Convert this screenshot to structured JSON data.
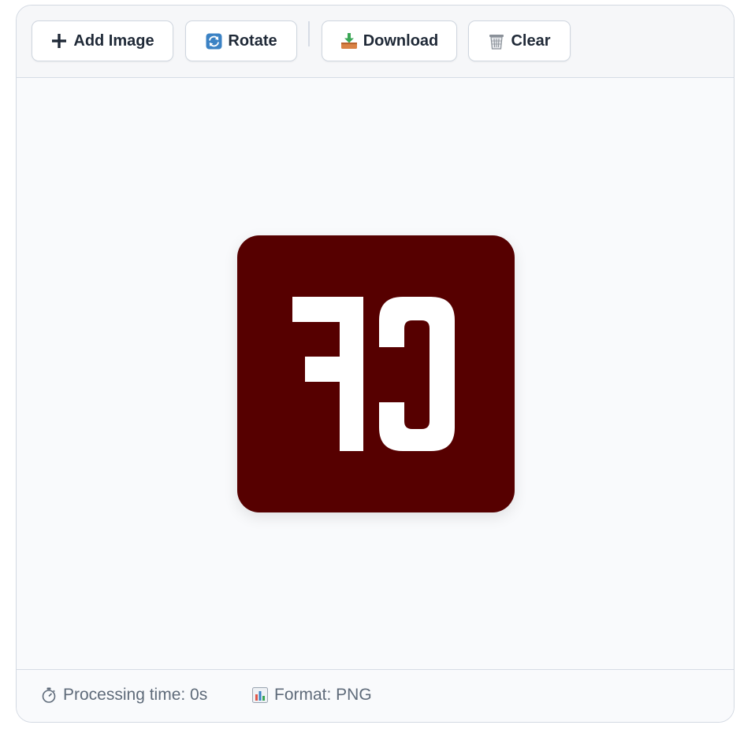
{
  "toolbar": {
    "add_image": {
      "label": "Add Image",
      "icon": "plus-icon"
    },
    "rotate": {
      "label": "Rotate",
      "icon": "rotate-icon"
    },
    "download": {
      "label": "Download",
      "icon": "download-icon"
    },
    "clear": {
      "label": "Clear",
      "icon": "trash-icon"
    }
  },
  "preview": {
    "image_text": "CF",
    "mirrored": true,
    "background_color": "#560000",
    "text_color": "#ffffff"
  },
  "footer": {
    "processing_time": {
      "label": "Processing time: 0s",
      "icon": "stopwatch-icon"
    },
    "format": {
      "label": "Format: PNG",
      "icon": "bar-chart-icon"
    }
  },
  "colors": {
    "panel_background": "#f9fafc",
    "toolbar_background": "#f6f7f9",
    "border": "#d3d9e2",
    "button_text": "#1f2937",
    "footer_text": "#5f6b7a"
  }
}
